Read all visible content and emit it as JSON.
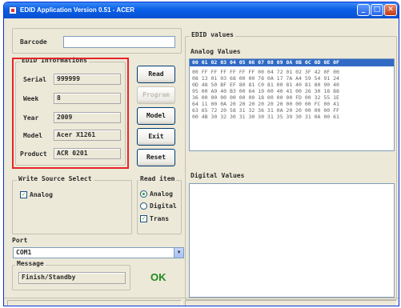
{
  "window": {
    "title": "EDID Application Version 0.51 - ACER"
  },
  "barcode": {
    "label": "Barcode",
    "value": ""
  },
  "edid_info": {
    "group_title": "EDID Informations",
    "serial_label": "Serial",
    "serial_value": "999999",
    "week_label": "Week",
    "week_value": "8",
    "year_label": "Year",
    "year_value": "2009",
    "model_label": "Model",
    "model_value": "Acer X1261",
    "product_label": "Product",
    "product_value": "ACR 0201",
    "highlight_color": "#e8242b"
  },
  "buttons": {
    "read": "Read",
    "program": "Program",
    "model": "Model",
    "exit": "Exit",
    "reset": "Reset"
  },
  "write_source": {
    "group_title": "Write Source Select",
    "analog_label": "Analog",
    "analog_checked": true
  },
  "read_item": {
    "group_title": "Read item",
    "analog_label": "Analog",
    "digital_label": "Digital",
    "trans_label": "Trans",
    "selected": "Analog",
    "trans_checked": true
  },
  "edid_values": {
    "group_title": "EDID values",
    "analog_title": "Analog Values",
    "header": "00 01 02 03 04 05 06 07 08 09 0A 0B 0C 0D 0E 0F",
    "rows": [
      "00 FF FF FF FF FF FF 00 04 72 01 02 3F 42 0F 00",
      "08 13 01 03 68 00 00 78 0A 17 7A A4 59 54 91 24",
      "0D 48 50 BF EF 80 81 C0 81 00 81 40 81 80 90 40",
      "95 00 A9 40 B3 00 64 19 00 40 41 00 26 30 18 88",
      "36 00 00 00 00 00 00 18 00 00 00 FD 00 32 55 1E",
      "64 11 00 0A 20 20 20 20 20 20 00 00 00 FC 00 41",
      "63 65 72 20 58 31 32 36 31 0A 20 20 00 00 00 FF",
      "00 4B 30 32 30 31 30 30 31 35 39 30 31 0A 00 61"
    ],
    "header_color": "#316ac5",
    "digital_title": "Digital Values"
  },
  "port": {
    "label": "Port",
    "value": "COM1"
  },
  "message": {
    "label": "Message",
    "value": "Finish/Standby",
    "status": "OK",
    "status_color": "#1f8a1f"
  }
}
